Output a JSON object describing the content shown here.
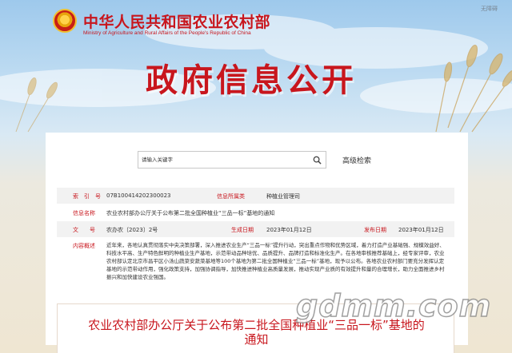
{
  "header": {
    "ministry_name_cn": "中华人民共和国农业农村部",
    "ministry_name_en": "Ministry of Agriculture and Rural Affairs of the People's Republic of China",
    "top_link": "无障碍"
  },
  "banner": {
    "title": "政府信息公开"
  },
  "search": {
    "placeholder": "请输入关键字",
    "advanced_label": "高级检索"
  },
  "info": {
    "index_label": "索　引　号",
    "index_value": "07B100414202300023",
    "category_label": "信息所属类",
    "category_value": "种植业管理司",
    "name_label": "信息名称",
    "name_value": "农业农村部办公厅关于公布第二批全国种植业“三品一标”基地的通知",
    "docno_label": "文　　号",
    "docno_value": "农办农〔2023〕2号",
    "gen_date_label": "生成日期",
    "gen_date_value": "2023年01月12日",
    "pub_date_label": "发布日期",
    "pub_date_value": "2023年01月12日",
    "summary_label": "内容概述",
    "summary_value": "近年来，各地认真贯彻落实中央决策部署，深入推进农业生产“三品一标”提升行动，突出重点作物和优势区域，着力打造产业基础强、规模效益好、科技水平高、生产特色鲜明的种植业生产基地，示范带动品种培优、品质提升、品牌打造和标准化生产。在各地审核推荐基础上，经专家评审，农业农村部认定北京市昌平区小汤山蔬菜安蔬菜基地等100个基地为第二批全国种植业“三品一标”基地，现予以公布。各地农业农村部门要充分发挥认定基地的示范带动作用，强化政策支持，加强协调指导，加快推进种植业高质量发展，推动实现产业质的有效提升和量的合理增长，助力全面推进乡村振兴和加快建设农业强国。"
  },
  "document": {
    "title_line1": "农业农村部办公厅关于公布第二批全国种植业“三品一标”基地的",
    "title_line2": "通知"
  },
  "watermark": "gdmm.com"
}
